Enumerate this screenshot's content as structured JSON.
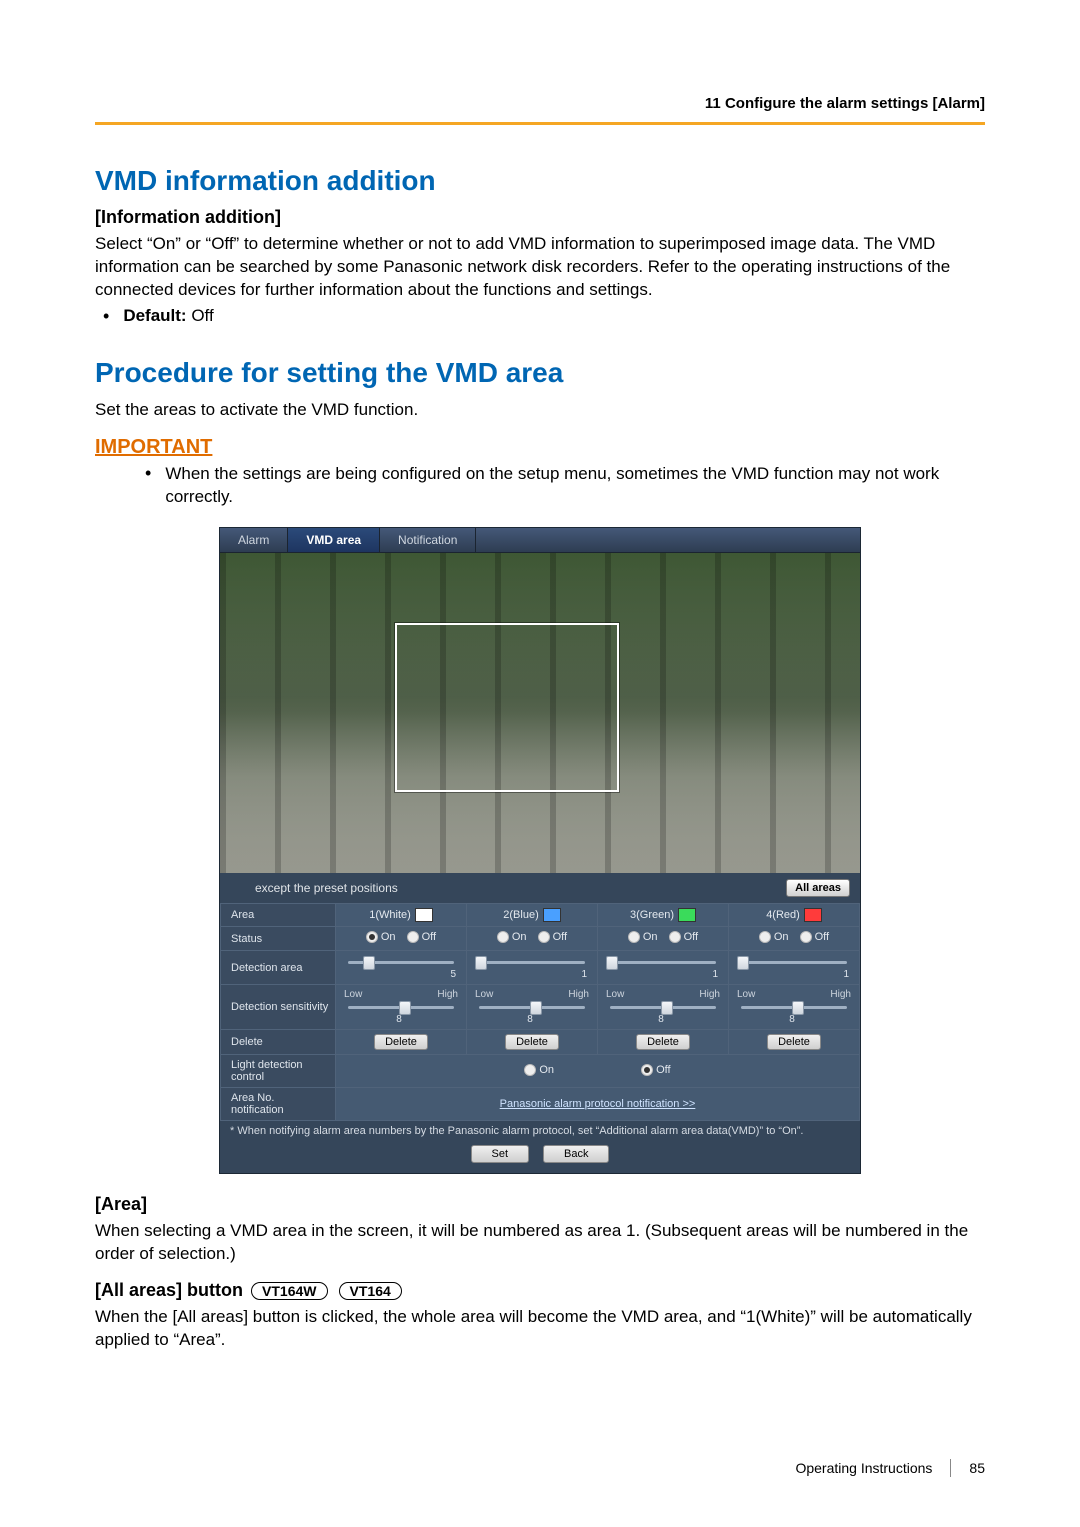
{
  "header": {
    "section": "11 Configure the alarm settings [Alarm]"
  },
  "section1": {
    "title": "VMD information addition",
    "subhead": "[Information addition]",
    "para": "Select “On” or “Off” to determine whether or not to add VMD information to superimposed image data. The VMD information can be searched by some Panasonic network disk recorders. Refer to the operating instructions of the connected devices for further information about the functions and settings.",
    "default_label": "Default:",
    "default_value": "Off"
  },
  "section2": {
    "title": "Procedure for setting the VMD area",
    "intro": "Set the areas to activate the VMD function.",
    "important_label": "IMPORTANT",
    "important_text": "When the settings are being configured on the setup menu, sometimes the VMD function may not work correctly."
  },
  "ui": {
    "tabs": {
      "t1": "Alarm",
      "t2": "VMD area",
      "t3": "Notification"
    },
    "preset_text": "except the preset positions",
    "all_areas_btn": "All areas",
    "rows": {
      "area": "Area",
      "status": "Status",
      "det_area": "Detection area",
      "det_sens": "Detection sensitivity",
      "delete": "Delete",
      "light": "Light detection control",
      "area_no": "Area No. notification"
    },
    "areas": [
      {
        "name": "1(White)",
        "color": "#ffffff",
        "status_on": true,
        "onoff_on": "On",
        "onoff_off": "Off",
        "det_area_val": "5",
        "sens_lo": "Low",
        "sens_hi": "High",
        "sens_val": "8"
      },
      {
        "name": "2(Blue)",
        "color": "#4aa0ff",
        "status_on": false,
        "onoff_on": "On",
        "onoff_off": "Off",
        "det_area_val": "1",
        "sens_lo": "Low",
        "sens_hi": "High",
        "sens_val": "8"
      },
      {
        "name": "3(Green)",
        "color": "#3adb5b",
        "status_on": false,
        "onoff_on": "On",
        "onoff_off": "Off",
        "det_area_val": "1",
        "sens_lo": "Low",
        "sens_hi": "High",
        "sens_val": "8"
      },
      {
        "name": "4(Red)",
        "color": "#ff3b3b",
        "status_on": false,
        "onoff_on": "On",
        "onoff_off": "Off",
        "det_area_val": "1",
        "sens_lo": "Low",
        "sens_hi": "High",
        "sens_val": "8"
      }
    ],
    "delete_btn": "Delete",
    "light_on": "On",
    "light_off": "Off",
    "proto_link": "Panasonic alarm protocol notification >>",
    "footnote": "* When notifying alarm area numbers by the Panasonic alarm protocol, set “Additional alarm area data(VMD)” to “On”.",
    "set_btn": "Set",
    "back_btn": "Back"
  },
  "area_section": {
    "head": "[Area]",
    "text": "When selecting a VMD area in the screen, it will be numbered as area 1. (Subsequent areas will be numbered in the order of selection.)"
  },
  "allareas_section": {
    "head": "[All areas] button",
    "badge1": "VT164W",
    "badge2": "VT164",
    "text": "When the [All areas] button is clicked, the whole area will become the VMD area, and “1(White)” will be automatically applied to “Area”."
  },
  "footer": {
    "label": "Operating Instructions",
    "page": "85"
  }
}
